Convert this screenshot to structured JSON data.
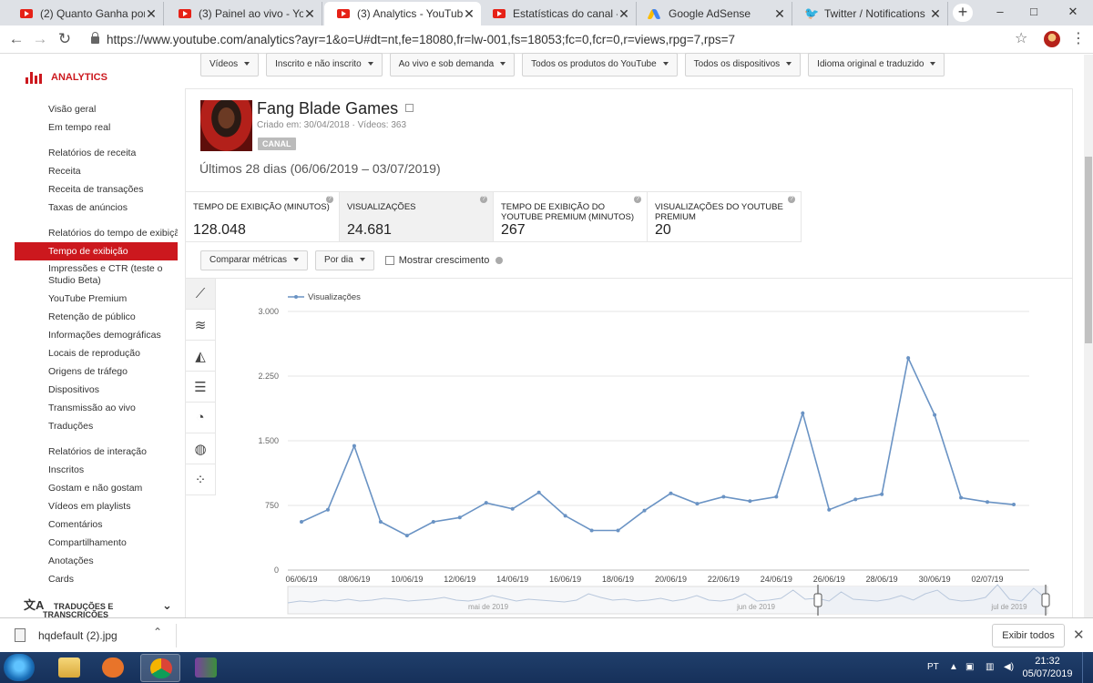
{
  "browser": {
    "tabs": [
      {
        "title": "(2) Quanto Ganha por Visu",
        "icon": "youtube"
      },
      {
        "title": "(3) Painel ao vivo - YouTub",
        "icon": "youtube"
      },
      {
        "title": "(3) Analytics - YouTube",
        "icon": "youtube",
        "active": true
      },
      {
        "title": "Estatísticas do canal - YouT",
        "icon": "youtube"
      },
      {
        "title": "Google AdSense",
        "icon": "adsense"
      },
      {
        "title": "Twitter / Notifications",
        "icon": "twitter"
      }
    ],
    "new_tab": "+",
    "window_minimize": "–",
    "window_maximize": "□",
    "window_close": "✕",
    "back": "←",
    "forward": "→",
    "reload": "↻",
    "url": "https://www.youtube.com/analytics?ayr=1&o=U#dt=nt,fe=18080,fr=lw-001,fs=18053;fc=0,fcr=0,r=views,rpg=7,rps=7",
    "bookmark_star": "☆",
    "menu": "⋮"
  },
  "sidebar": {
    "title": "ANALYTICS",
    "items": [
      {
        "label": "Visão geral"
      },
      {
        "label": "Em tempo real"
      },
      {
        "label": "Relatórios de receita",
        "group": true
      },
      {
        "label": "Receita"
      },
      {
        "label": "Receita de transações"
      },
      {
        "label": "Taxas de anúncios"
      },
      {
        "label": "Relatórios do tempo de exibição",
        "group": true
      },
      {
        "label": "Tempo de exibição",
        "active": true
      },
      {
        "label": "Impressões e CTR (teste o Studio Beta)",
        "multi": true
      },
      {
        "label": "YouTube Premium"
      },
      {
        "label": "Retenção de público"
      },
      {
        "label": "Informações demográficas"
      },
      {
        "label": "Locais de reprodução"
      },
      {
        "label": "Origens de tráfego"
      },
      {
        "label": "Dispositivos"
      },
      {
        "label": "Transmissão ao vivo"
      },
      {
        "label": "Traduções"
      },
      {
        "label": "Relatórios de interação",
        "group": true
      },
      {
        "label": "Inscritos"
      },
      {
        "label": "Gostam e não gostam"
      },
      {
        "label": "Vídeos em playlists"
      },
      {
        "label": "Comentários"
      },
      {
        "label": "Compartilhamento"
      },
      {
        "label": "Anotações"
      },
      {
        "label": "Cards"
      }
    ],
    "footer_line1": "TRADUÇÕES E",
    "footer_line2": "TRANSCRIÇÕES",
    "footer_icon": "文A",
    "footer_chevron": "⌄"
  },
  "filters": [
    "Vídeos",
    "Inscrito e não inscrito",
    "Ao vivo e sob demanda",
    "Todos os produtos do YouTube",
    "Todos os dispositivos",
    "Idioma original e traduzido"
  ],
  "channel": {
    "name": "Fang Blade Games",
    "created": "Criado em: 30/04/2018",
    "separator": " · ",
    "videos": "Vídeos: 363",
    "badge": "CANAL"
  },
  "period": "Últimos 28 dias (06/06/2019 – 03/07/2019)",
  "metrics": [
    {
      "label": "TEMPO DE EXIBIÇÃO (MINUTOS)",
      "value": "128.048"
    },
    {
      "label": "VISUALIZAÇÕES",
      "value": "24.681",
      "selected": true
    },
    {
      "label": "TEMPO DE EXIBIÇÃO DO YOUTUBE PREMIUM (MINUTOS)",
      "value": "267"
    },
    {
      "label": "VISUALIZAÇÕES DO YOUTUBE PREMIUM",
      "value": "20"
    }
  ],
  "help_mark": "?",
  "controls": {
    "compare": "Comparar métricas",
    "per": "Por dia",
    "growth": "Mostrar crescimento"
  },
  "chart_icons": [
    "line-chart-icon",
    "multi-line-icon",
    "area-chart-icon",
    "bar-chart-icon",
    "pie-chart-icon",
    "globe-icon",
    "bubble-chart-icon"
  ],
  "chart_data": {
    "type": "line",
    "legend_position": "top-left",
    "grid": true,
    "series": [
      {
        "name": "Visualizações",
        "color": "#6a93c4",
        "values": [
          560,
          700,
          1440,
          560,
          400,
          560,
          610,
          780,
          710,
          900,
          630,
          460,
          460,
          690,
          890,
          770,
          850,
          800,
          850,
          1820,
          700,
          820,
          880,
          2460,
          1800,
          840,
          790,
          760
        ]
      }
    ],
    "x": [
      "06/06/19",
      "07/06/19",
      "08/06/19",
      "09/06/19",
      "10/06/19",
      "11/06/19",
      "12/06/19",
      "13/06/19",
      "14/06/19",
      "15/06/19",
      "16/06/19",
      "17/06/19",
      "18/06/19",
      "19/06/19",
      "20/06/19",
      "21/06/19",
      "22/06/19",
      "23/06/19",
      "24/06/19",
      "25/06/19",
      "26/06/19",
      "27/06/19",
      "28/06/19",
      "29/06/19",
      "30/06/19",
      "01/07/19",
      "02/07/19",
      "03/07/19"
    ],
    "x_tick_labels": [
      "06/06/19",
      "08/06/19",
      "10/06/19",
      "12/06/19",
      "14/06/19",
      "16/06/19",
      "18/06/19",
      "20/06/19",
      "22/06/19",
      "24/06/19",
      "26/06/19",
      "28/06/19",
      "30/06/19",
      "02/07/19"
    ],
    "y_ticks": [
      "0",
      "750",
      "1.500",
      "2.250",
      "3.000"
    ],
    "ylim": [
      0,
      3000
    ],
    "navigator_labels": [
      "mai de 2019",
      "jun de 2019",
      "jul de 2019"
    ]
  },
  "downloads": {
    "file": "hqdefault (2).jpg",
    "chevron": "⌃",
    "show_all": "Exibir todos",
    "close": "✕"
  },
  "taskbar": {
    "lang": "PT",
    "time": "21:32",
    "date": "05/07/2019"
  }
}
